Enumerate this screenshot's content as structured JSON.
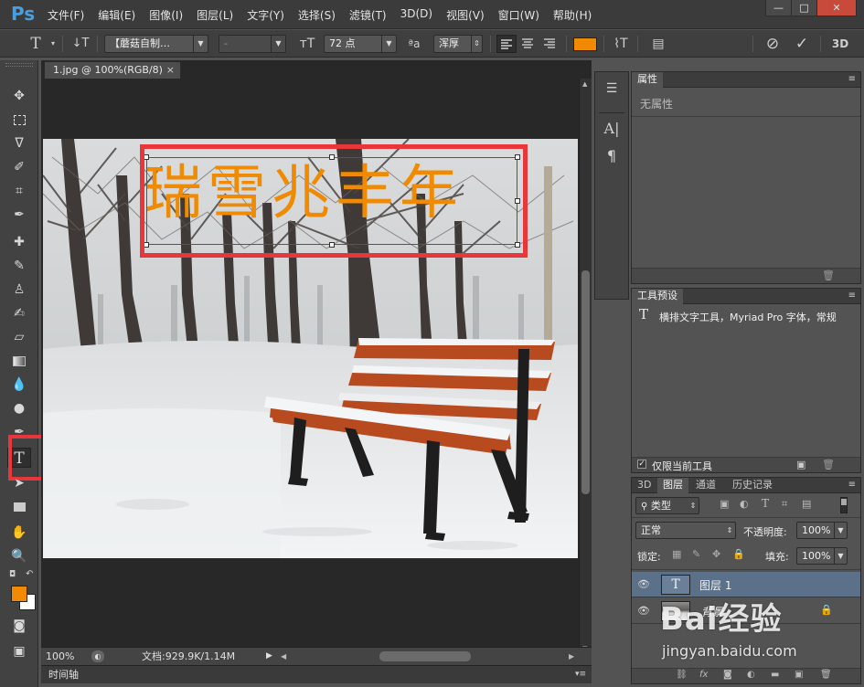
{
  "app": {
    "logo": "Ps"
  },
  "menu": [
    "文件(F)",
    "编辑(E)",
    "图像(I)",
    "图层(L)",
    "文字(Y)",
    "选择(S)",
    "滤镜(T)",
    "3D(D)",
    "视图(V)",
    "窗口(W)",
    "帮助(H)"
  ],
  "window_controls": {
    "minimize": "—",
    "maximize": "□",
    "close": "✕"
  },
  "options": {
    "font_family": "【蘑菇自制…",
    "font_style": "-",
    "font_size": "72 点",
    "aa_label": "ªa",
    "anti_alias": "浑厚",
    "text_color": "#f08a00",
    "cancel": "⊘",
    "commit": "✓",
    "threed": "3D"
  },
  "document": {
    "tab_title": "1.jpg @ 100%(RGB/8)",
    "tab_close": "×",
    "canvas_text": "瑞雪兆丰年",
    "text_color": "#f08a00",
    "highlight_color": "#e8373a"
  },
  "status": {
    "zoom": "100%",
    "doc_info": "文档:929.9K/1.14M",
    "timeline_label": "时间轴"
  },
  "colors": {
    "foreground": "#f08a00",
    "background": "#ffffff"
  },
  "properties_panel": {
    "tab": "属性",
    "content": "无属性"
  },
  "tool_presets_panel": {
    "tab": "工具预设",
    "item": "横排文字工具，Myriad Pro 字体，常规",
    "checkbox_label": "仅限当前工具"
  },
  "layers_panel": {
    "tabs": [
      "3D",
      "图层",
      "通道",
      "历史记录"
    ],
    "active_tab": 1,
    "filter_kind": "类型",
    "blend_mode": "正常",
    "opacity_label": "不透明度:",
    "opacity": "100%",
    "lock_label": "锁定:",
    "fill_label": "填充:",
    "fill": "100%",
    "layers": [
      {
        "name": "图层 1",
        "type": "text"
      },
      {
        "name": "背景",
        "type": "image"
      }
    ]
  },
  "watermark": {
    "brand": "Bai经验",
    "url": "jingyan.baidu.com"
  }
}
